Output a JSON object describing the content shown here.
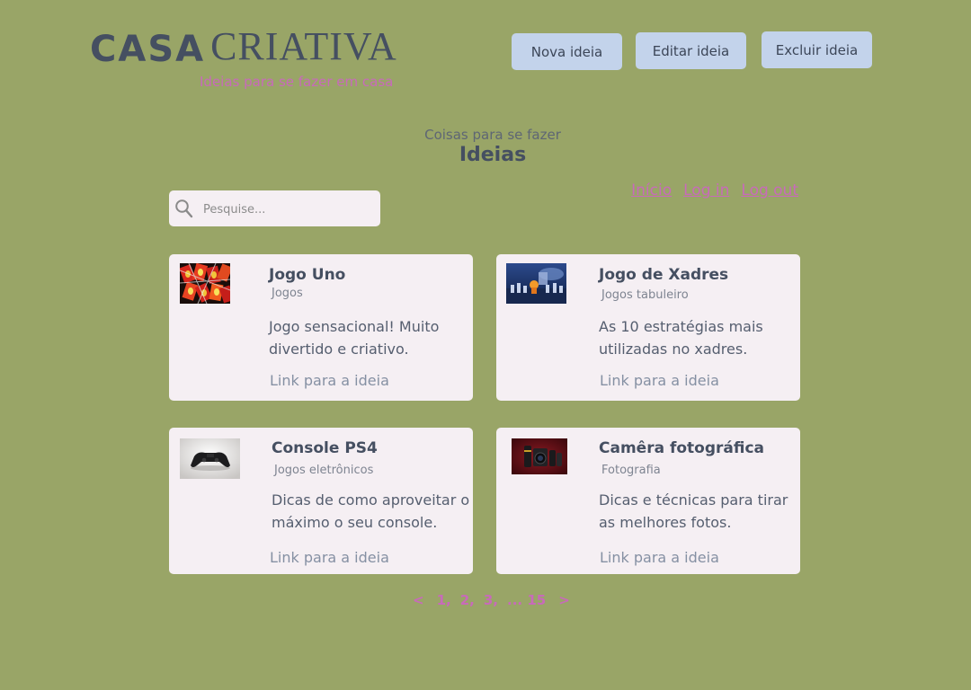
{
  "brand": {
    "title_bold": "CASA",
    "title_light": "CRIATIVA",
    "subtitle": "Ideias para se fazer em casa"
  },
  "header_buttons": {
    "new": "Nova ideia",
    "edit": "Editar ideia",
    "delete": "Excluir ideia"
  },
  "section": {
    "subtitle": "Coisas para se fazer",
    "title": "Ideias"
  },
  "search": {
    "placeholder": "Pesquise...",
    "icon": "search-icon"
  },
  "nav": {
    "home": "Início",
    "login": "Log in",
    "logout": "Log out"
  },
  "cards": [
    {
      "title": "Jogo Uno",
      "category": "Jogos",
      "description": "Jogo sensacional! Muito divertido e criativo.",
      "link": "Link para a ideia",
      "image": "uno-cards-image"
    },
    {
      "title": "Jogo de Xadres",
      "category": "Jogos tabuleiro",
      "description": "As 10 estratégias mais utilizadas no xadres.",
      "link": "Link para a ideia",
      "image": "chess-image"
    },
    {
      "title": "Console PS4",
      "category": "Jogos eletrônicos",
      "description": "Dicas de como aproveitar o máximo o seu console.",
      "link": "Link para a ideia",
      "image": "ps4-controller-image"
    },
    {
      "title": "Camêra fotográfica",
      "category": "Fotografia",
      "description": "Dicas e técnicas para tirar as melhores fotos.",
      "link": "Link para a ideia",
      "image": "camera-image"
    }
  ],
  "pagination": {
    "prev": "<",
    "pages": [
      "1,",
      "2,",
      "3,",
      "... 15"
    ],
    "next": ">"
  },
  "colors": {
    "background": "#99a567",
    "card": "#f5eff3",
    "button": "#c3d3eb",
    "accent": "#c86aba",
    "text_dark": "#454f61"
  }
}
